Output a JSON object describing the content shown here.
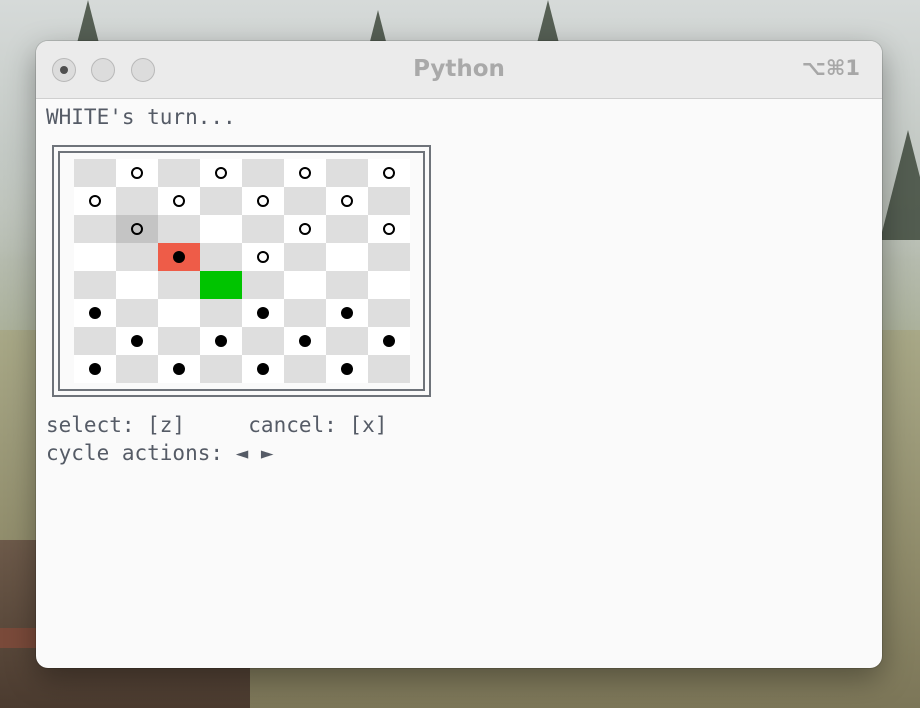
{
  "window": {
    "title": "Python",
    "shortcut": "⌥⌘1"
  },
  "status": {
    "turn_text": "WHITE's turn..."
  },
  "controls": {
    "select_cancel_text": "select: [z]     cancel: [x]",
    "cycle_text": "cycle actions: ◄ ►"
  },
  "colors": {
    "light_square": "#ffffff",
    "dark_square": "#dedede",
    "cursor": "#c4c4c4",
    "selected_piece": "#ee5c48",
    "move_target": "#00c400"
  },
  "board": {
    "rows": 8,
    "cols": 8,
    "pieces": [
      {
        "row": 0,
        "col": 1,
        "color": "white"
      },
      {
        "row": 0,
        "col": 3,
        "color": "white"
      },
      {
        "row": 0,
        "col": 5,
        "color": "white"
      },
      {
        "row": 0,
        "col": 7,
        "color": "white"
      },
      {
        "row": 1,
        "col": 0,
        "color": "white"
      },
      {
        "row": 1,
        "col": 2,
        "color": "white"
      },
      {
        "row": 1,
        "col": 4,
        "color": "white"
      },
      {
        "row": 1,
        "col": 6,
        "color": "white"
      },
      {
        "row": 2,
        "col": 1,
        "color": "white"
      },
      {
        "row": 2,
        "col": 5,
        "color": "white"
      },
      {
        "row": 2,
        "col": 7,
        "color": "white"
      },
      {
        "row": 3,
        "col": 2,
        "color": "black"
      },
      {
        "row": 3,
        "col": 4,
        "color": "white"
      },
      {
        "row": 5,
        "col": 0,
        "color": "black"
      },
      {
        "row": 5,
        "col": 4,
        "color": "black"
      },
      {
        "row": 5,
        "col": 6,
        "color": "black"
      },
      {
        "row": 6,
        "col": 1,
        "color": "black"
      },
      {
        "row": 6,
        "col": 3,
        "color": "black"
      },
      {
        "row": 6,
        "col": 5,
        "color": "black"
      },
      {
        "row": 6,
        "col": 7,
        "color": "black"
      },
      {
        "row": 7,
        "col": 0,
        "color": "black"
      },
      {
        "row": 7,
        "col": 2,
        "color": "black"
      },
      {
        "row": 7,
        "col": 4,
        "color": "black"
      },
      {
        "row": 7,
        "col": 6,
        "color": "black"
      }
    ],
    "highlights": [
      {
        "row": 2,
        "col": 1,
        "kind": "cursor"
      },
      {
        "row": 3,
        "col": 2,
        "kind": "selected_piece"
      },
      {
        "row": 4,
        "col": 3,
        "kind": "move_target"
      }
    ]
  }
}
